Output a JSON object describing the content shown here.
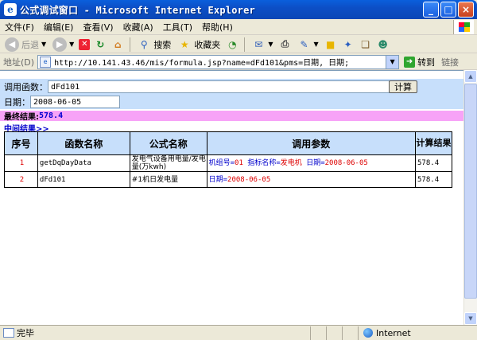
{
  "window": {
    "title": "公式调试窗口 - Microsoft Internet Explorer",
    "buttons": [
      "_",
      "□",
      "×"
    ]
  },
  "menu": [
    "文件(F)",
    "编辑(E)",
    "查看(V)",
    "收藏(A)",
    "工具(T)",
    "帮助(H)"
  ],
  "toolbar": {
    "back": "后退",
    "search": "搜索",
    "favorites": "收藏夹"
  },
  "address": {
    "label": "地址(D)",
    "url": "http://10.141.43.46/mis/formula.jsp?name=dFd101&pms=日期, 日期;",
    "go": "转到",
    "links": "链接"
  },
  "form": {
    "call_function_label": "调用函数：",
    "call_function_value": "dFd101",
    "calc_button": "计算",
    "date_label": "日期：",
    "date_value": "2008-06-05"
  },
  "final_result": {
    "label": "最终结果:",
    "value": "578.4"
  },
  "intermediate_link": "中间结果>>",
  "table": {
    "headers": [
      "序号",
      "函数名称",
      "公式名称",
      "调用参数",
      "计算结果"
    ],
    "rows": [
      {
        "index": "1",
        "function": "getDqDayData",
        "formula": "发电气设备用电量/发电量(万kwh)",
        "params": [
          {
            "k": "机组号",
            "v": "01"
          },
          {
            "k": "指标名称",
            "v": "发电机"
          },
          {
            "k": "日期",
            "v": "2008-06-05"
          }
        ],
        "result": "578.4"
      },
      {
        "index": "2",
        "function": "dFd101",
        "formula": "#1机日发电量",
        "params": [
          {
            "k": "日期",
            "v": "2008-06-05"
          }
        ],
        "result": "578.4"
      }
    ]
  },
  "status": {
    "text": "完毕",
    "zone": "Internet"
  }
}
